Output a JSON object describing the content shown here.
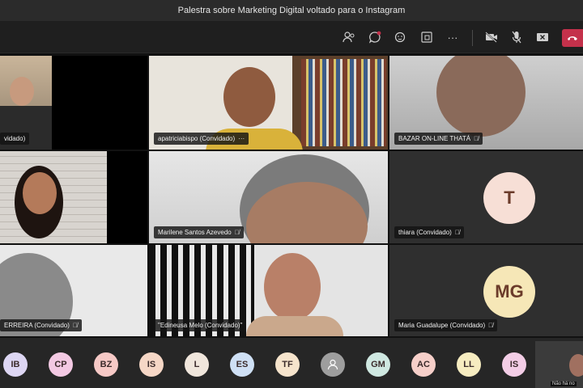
{
  "window": {
    "title": "Palestra sobre Marketing Digital voltado para o Instagram"
  },
  "toolbar": {
    "icons": [
      "participants-icon",
      "chat-icon",
      "reactions-icon",
      "share-tray-icon",
      "more-actions-icon",
      "camera-off-icon",
      "mic-off-icon",
      "share-screen-icon",
      "hangup-icon"
    ],
    "more_label": "···"
  },
  "tiles": [
    {
      "name": "vidado)",
      "muted": false
    },
    {
      "name": "apatriciabispo (Convidado)",
      "more": "···"
    },
    {
      "name": "BAZAR ON-LINE THATÁ",
      "muted": true
    },
    {
      "name": "",
      "muted": false
    },
    {
      "name": "Marilene Santos Azevedo",
      "muted": true
    },
    {
      "name": "thiara (Convidado)",
      "muted": true,
      "initials": "T",
      "avatar_color": "#f7dfd6"
    },
    {
      "name": "ERREIRA (Convidado)",
      "muted": true
    },
    {
      "name": "\"Edineusa Melo (Convidado)\"",
      "muted": false
    },
    {
      "name": "Maria Guadalupe (Convidado)",
      "muted": true,
      "initials": "MG",
      "avatar_color": "#f6e7b7"
    }
  ],
  "roster": [
    {
      "initials": "IB",
      "color": "#ddd6f3"
    },
    {
      "initials": "CP",
      "color": "#f3c9e3"
    },
    {
      "initials": "BZ",
      "color": "#f6c9c6"
    },
    {
      "initials": "IS",
      "color": "#f6d7c6"
    },
    {
      "initials": "L",
      "color": "#f0e6dc"
    },
    {
      "initials": "ES",
      "color": "#cfe0f5"
    },
    {
      "initials": "TF",
      "color": "#f6e4cc"
    },
    {
      "initials": "",
      "color": "#9e9e9e",
      "icon": "person-icon"
    },
    {
      "initials": "GM",
      "color": "#cfe8e1"
    },
    {
      "initials": "AC",
      "color": "#f6cfc9"
    },
    {
      "initials": "LL",
      "color": "#f6ecc0"
    },
    {
      "initials": "IS",
      "color": "#f3cde6"
    }
  ],
  "self_view": {
    "caption": "Não há no"
  }
}
